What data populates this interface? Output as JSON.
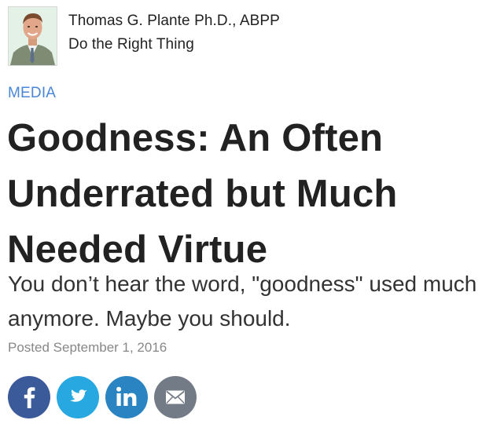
{
  "author": {
    "name": "Thomas G. Plante Ph.D., ABPP",
    "blog": "Do the Right Thing",
    "avatar_icon": "author-portrait"
  },
  "article": {
    "category": "MEDIA",
    "headline": "Goodness: An Often Underrated but Much Needed Virtue",
    "subhead": "You don’t hear the word, \"goodness\" used much anymore. Maybe you should.",
    "posted": "Posted September 1, 2016"
  },
  "share": {
    "buttons": [
      {
        "network": "facebook",
        "icon": "facebook-icon",
        "color": "#3b5a9a"
      },
      {
        "network": "twitter",
        "icon": "twitter-icon",
        "color": "#27a8e0"
      },
      {
        "network": "linkedin",
        "icon": "linkedin-icon",
        "color": "#2a84c2"
      },
      {
        "network": "email",
        "icon": "envelope-icon",
        "color": "#737b86"
      }
    ]
  },
  "colors": {
    "category": "#4a86d8",
    "text": "#222222",
    "muted": "#888888"
  }
}
